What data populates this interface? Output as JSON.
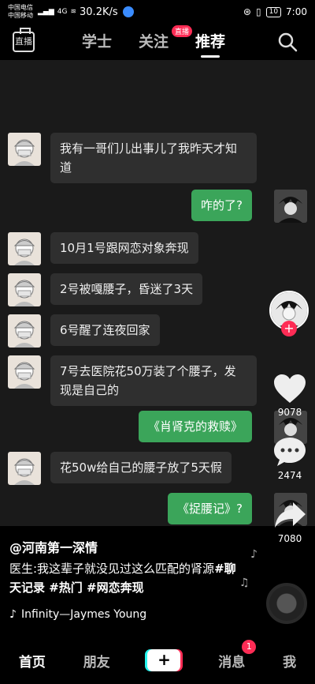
{
  "status": {
    "carrier1": "中国电信",
    "carrier2": "中国移动",
    "network": "4G",
    "speed": "30.2K/s",
    "battery": "10",
    "time": "7:00"
  },
  "top_nav": {
    "live_label": "直播",
    "tabs": [
      "学士",
      "关注",
      "推荐"
    ],
    "live_badge": "直播"
  },
  "chat": {
    "messages": [
      {
        "side": "left",
        "text": "我有一哥们儿出事儿了我昨天才知道"
      },
      {
        "side": "right",
        "text": "咋的了?"
      },
      {
        "side": "left",
        "text": "10月1号跟网恋对象奔现"
      },
      {
        "side": "left",
        "text": "2号被嘎腰子，昏迷了3天"
      },
      {
        "side": "left",
        "text": "6号醒了连夜回家"
      },
      {
        "side": "left",
        "text": "7号去医院花50万装了个腰子，发现是自己的"
      },
      {
        "side": "right",
        "text": "《肖肾克的救赎》"
      },
      {
        "side": "left",
        "text": "花50w给自己的腰子放了5天假"
      },
      {
        "side": "right",
        "text": "《捉腰记》?"
      }
    ]
  },
  "actions": {
    "likes": "9078",
    "comments": "2474",
    "shares": "7080"
  },
  "post": {
    "author": "@河南第一深情",
    "caption": "医生:我这辈子就没见过这么匹配的肾源",
    "tags": "#聊天记录 #热门 #网恋奔现",
    "music": "Infinity—Jaymes Young"
  },
  "bottom_nav": {
    "home": "首页",
    "friends": "朋友",
    "plus": "+",
    "messages": "消息",
    "messages_badge": "1",
    "me": "我"
  }
}
